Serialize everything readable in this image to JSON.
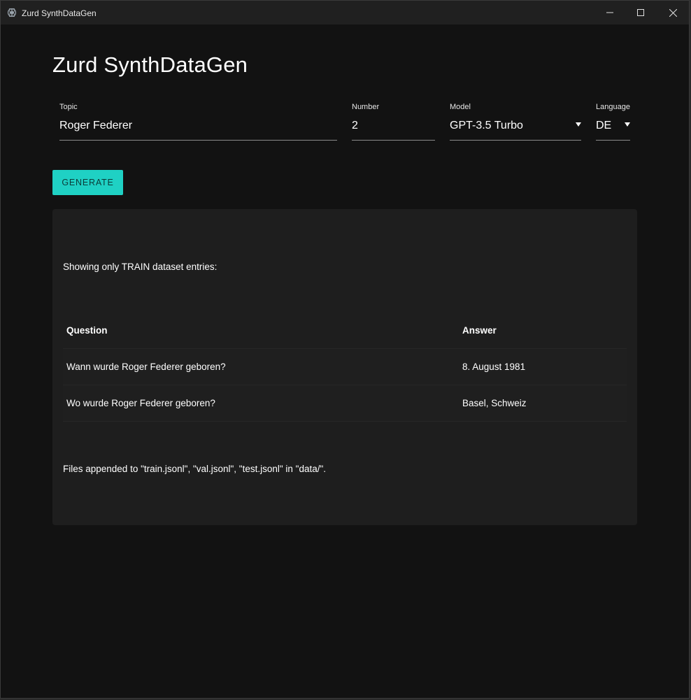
{
  "window": {
    "title": "Zurd SynthDataGen",
    "icon": "app-logo-icon",
    "controls": [
      "minimize-icon",
      "maximize-icon",
      "close-icon"
    ]
  },
  "heading": "Zurd SynthDataGen",
  "form": {
    "topic": {
      "label": "Topic",
      "value": "Roger Federer"
    },
    "number": {
      "label": "Number",
      "value": "2"
    },
    "model": {
      "label": "Model",
      "value": "GPT-3.5 Turbo"
    },
    "language": {
      "label": "Language",
      "value": "DE"
    }
  },
  "generate_label": "GENERATE",
  "results": {
    "info": "Showing only TRAIN dataset entries:",
    "columns": {
      "question": "Question",
      "answer": "Answer"
    },
    "rows": [
      {
        "question": "Wann wurde Roger Federer geboren?",
        "answer": "8. August 1981"
      },
      {
        "question": "Wo wurde Roger Federer geboren?",
        "answer": "Basel, Schweiz"
      }
    ],
    "footer": "Files appended to \"train.jsonl\", \"val.jsonl\", \"test.jsonl\" in \"data/\"."
  },
  "colors": {
    "background": "#121212",
    "panel": "#1e1e1e",
    "accent": "#1fd1c4",
    "titlebar": "#202020"
  }
}
